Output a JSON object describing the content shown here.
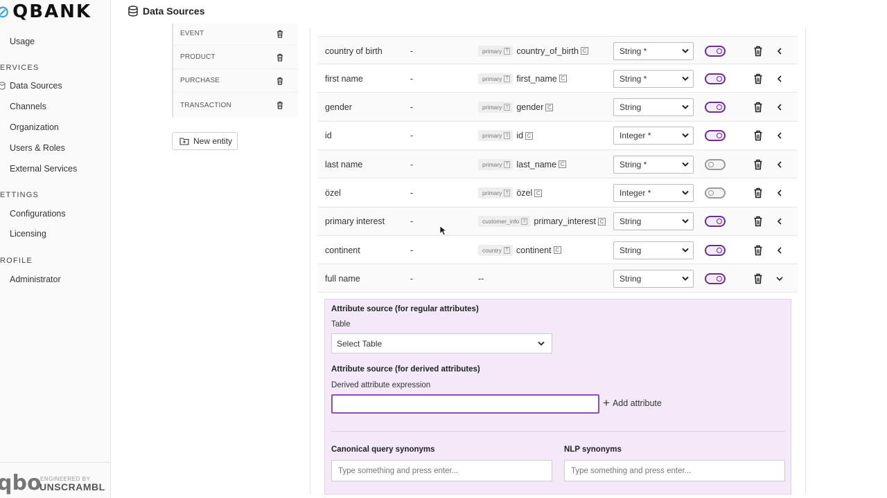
{
  "app": {
    "brand": "QBANK"
  },
  "header": {
    "title": "Data Sources"
  },
  "sidebar": {
    "top_items": [
      {
        "label": "Usage",
        "icon": "usage-icon"
      }
    ],
    "sections": [
      {
        "title": "ERVICES",
        "items": [
          {
            "label": "Data Sources",
            "icon": "database-icon"
          },
          {
            "label": "Channels",
            "icon": "channels-icon"
          },
          {
            "label": "Organization",
            "icon": "organization-icon"
          },
          {
            "label": "Users & Roles",
            "icon": "users-icon"
          },
          {
            "label": "External Services",
            "icon": "external-icon"
          }
        ]
      },
      {
        "title": "ETTINGS",
        "items": [
          {
            "label": "Configurations",
            "icon": "config-icon"
          },
          {
            "label": "Licensing",
            "icon": "license-icon"
          }
        ]
      },
      {
        "title": "ROFILE",
        "items": [
          {
            "label": "Administrator",
            "icon": "user-icon"
          }
        ]
      }
    ],
    "footer": {
      "logo": "qbo",
      "engineered_by": "ENGINEERED BY",
      "company": "UNSCRAMBL"
    }
  },
  "entities": {
    "items": [
      "EVENT",
      "PRODUCT",
      "PURCHASE",
      "TRANSACTION"
    ],
    "new_button": "New entity"
  },
  "attributes": {
    "rows": [
      {
        "name": "country of birth",
        "desc": "-",
        "table": "primary",
        "column": "country_of_birth",
        "type": "String *",
        "enabled": true,
        "expanded": false
      },
      {
        "name": "first name",
        "desc": "-",
        "table": "primary",
        "column": "first_name",
        "type": "String *",
        "enabled": true,
        "expanded": false
      },
      {
        "name": "gender",
        "desc": "-",
        "table": "primary",
        "column": "gender",
        "type": "String",
        "enabled": true,
        "expanded": false
      },
      {
        "name": "id",
        "desc": "-",
        "table": "primary",
        "column": "id",
        "type": "Integer *",
        "enabled": true,
        "expanded": false
      },
      {
        "name": "last name",
        "desc": "-",
        "table": "primary",
        "column": "last_name",
        "type": "String *",
        "enabled": false,
        "expanded": false
      },
      {
        "name": "özel",
        "desc": "-",
        "table": "primary",
        "column": "özel",
        "type": "Integer *",
        "enabled": false,
        "expanded": false
      },
      {
        "name": "primary interest",
        "desc": "-",
        "table": "customer_info",
        "column": "primary_interest",
        "type": "String",
        "enabled": true,
        "expanded": false
      },
      {
        "name": "continent",
        "desc": "-",
        "table": "country",
        "column": "continent",
        "type": "String",
        "enabled": true,
        "expanded": false
      },
      {
        "name": "full name",
        "desc": "-",
        "table": "",
        "column": "--",
        "type": "String",
        "enabled": true,
        "expanded": true
      }
    ],
    "chip_table_mark": "T",
    "chip_column_mark": "C"
  },
  "panel": {
    "regular_heading": "Attribute source (for regular attributes)",
    "table_label": "Table",
    "table_select": "Select Table",
    "derived_heading": "Attribute source (for derived attributes)",
    "expression_label": "Derived attribute expression",
    "expression_value": "",
    "add_attribute": "Add attribute",
    "canonical_heading": "Canonical query synonyms",
    "canonical_placeholder": "Type something and press enter...",
    "nlp_heading": "NLP synonyms",
    "nlp_placeholder": "Type something and press enter..."
  },
  "colors": {
    "accent": "#6a2d91",
    "panel_bg": "#f3e9f8",
    "brand_q": "#3ba7d9"
  }
}
